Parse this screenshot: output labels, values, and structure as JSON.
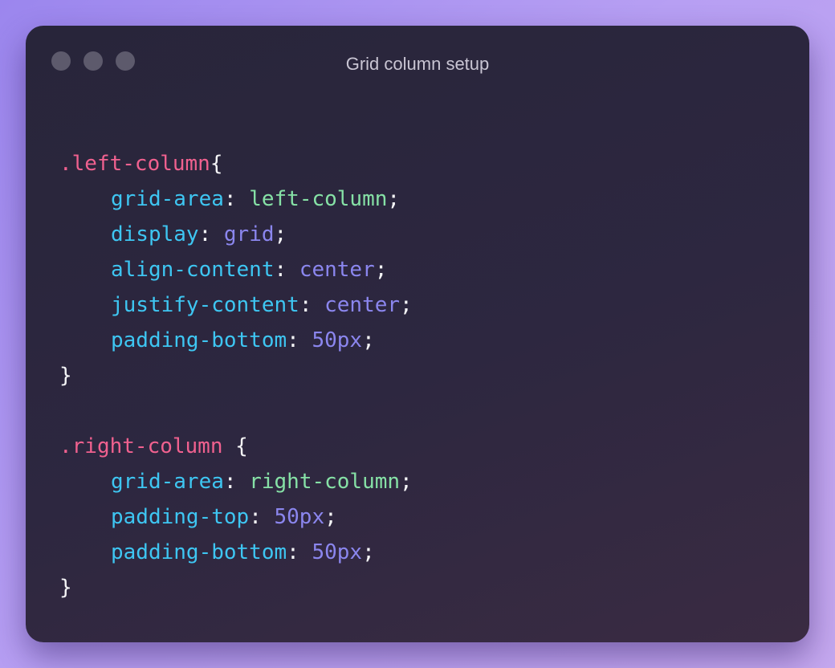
{
  "window": {
    "title": "Grid column setup",
    "controls": [
      "dot-1",
      "dot-2",
      "dot-3"
    ]
  },
  "colors": {
    "selector": "#f0618f",
    "property": "#3ec6f2",
    "string_value": "#86e1a6",
    "keyword_value": "#8b86ee",
    "punctuation": "#f4f4f6"
  },
  "code": {
    "block1": {
      "selector": ".left-column",
      "open": "{",
      "decls": [
        {
          "prop": "grid-area",
          "value": "left-column"
        },
        {
          "prop": "display",
          "value": "grid"
        },
        {
          "prop": "align-content",
          "value": "center"
        },
        {
          "prop": "justify-content",
          "value": "center"
        },
        {
          "prop": "padding-bottom",
          "value": "50px"
        }
      ],
      "close": "}"
    },
    "block2": {
      "selector": ".right-column",
      "open": " {",
      "decls": [
        {
          "prop": "grid-area",
          "value": "right-column"
        },
        {
          "prop": "padding-top",
          "value": "50px"
        },
        {
          "prop": "padding-bottom",
          "value": "50px"
        }
      ],
      "close": "}"
    },
    "colon": ": ",
    "semicolon": ";"
  }
}
